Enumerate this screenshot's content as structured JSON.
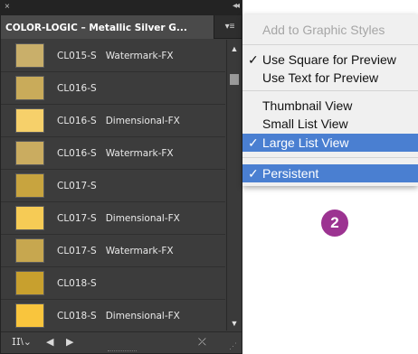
{
  "panel": {
    "close_glyph": "×",
    "collapse_glyph": "◂◂",
    "tab_title": "COLOR-LOGIC – Metallic Silver G...",
    "menu_glyph": "▾≡",
    "scroll_up": "▲",
    "scroll_down": "▼",
    "rows": [
      {
        "code": "CL015-S",
        "effect": "Watermark-FX",
        "color": "#c9af6a"
      },
      {
        "code": "CL016-S",
        "effect": "",
        "color": "#c9ab5a"
      },
      {
        "code": "CL016-S",
        "effect": "Dimensional-FX",
        "color": "#f6d06a"
      },
      {
        "code": "CL016-S",
        "effect": "Watermark-FX",
        "color": "#caac60"
      },
      {
        "code": "CL017-S",
        "effect": "",
        "color": "#c8a43f"
      },
      {
        "code": "CL017-S",
        "effect": "Dimensional-FX",
        "color": "#f6cb55"
      },
      {
        "code": "CL017-S",
        "effect": "Watermark-FX",
        "color": "#c7a74f"
      },
      {
        "code": "CL018-S",
        "effect": "",
        "color": "#c8a02e"
      },
      {
        "code": "CL018-S",
        "effect": "Dimensional-FX",
        "color": "#f9c53d"
      }
    ],
    "bottom": {
      "library_icon": "𝖨𝖨\\⌄",
      "prev_glyph": "◀",
      "next_glyph": "▶",
      "delete_glyph": "⤫",
      "resize_glyph": "⋰"
    }
  },
  "menu": {
    "add_graphic_styles": "Add to Graphic Styles",
    "use_square": "Use Square for Preview",
    "use_text": "Use Text for Preview",
    "thumbnail_view": "Thumbnail View",
    "small_list_view": "Small List View",
    "large_list_view": "Large List View",
    "persistent": "Persistent",
    "check": "✓"
  },
  "badge": "2"
}
